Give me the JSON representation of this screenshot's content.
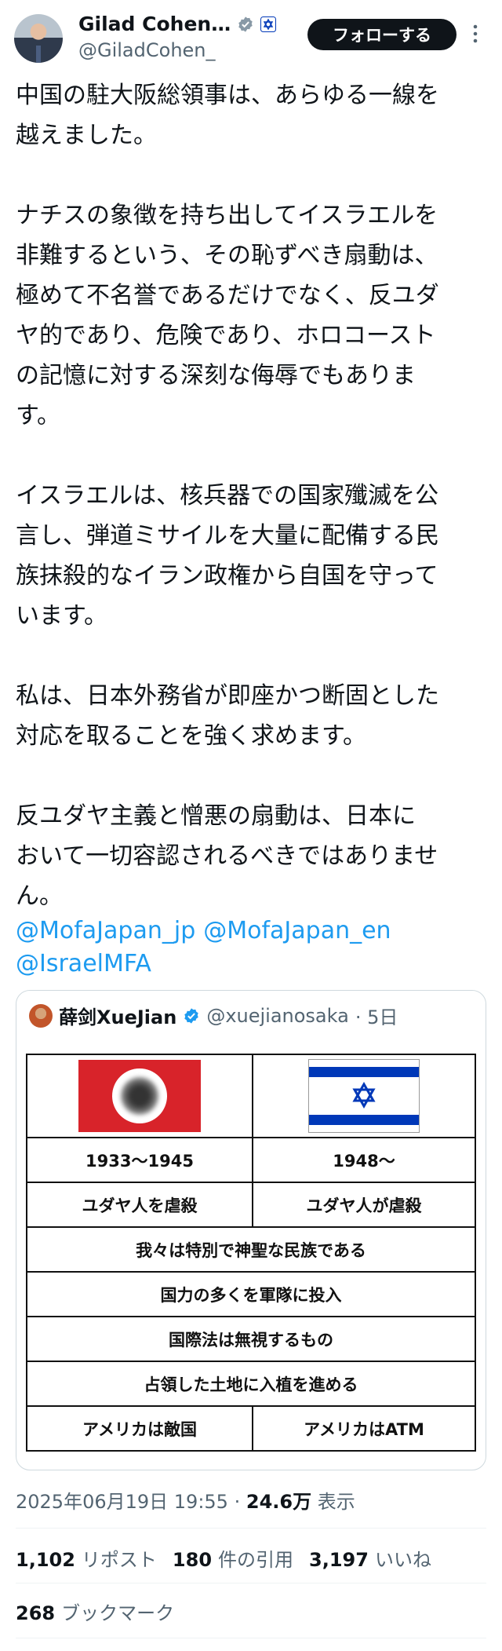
{
  "author": {
    "name": "Gilad Cohen…",
    "handle": "@GiladCohen_",
    "follow_label": "フォローする"
  },
  "tweet": {
    "paragraphs": [
      "中国の駐大阪総領事は、あらゆる一線を\n越えました。",
      "ナチスの象徴を持ち出してイスラエルを\n非難するという、その恥ずべき扇動は、\n極めて不名誉であるだけでなく、反ユダ\nヤ的であり、危険であり、ホロコースト\nの記憶に対する深刻な侮辱でもありま\nす。",
      "イスラエルは、核兵器での国家殲滅を公\n言し、弾道ミサイルを大量に配備する民\n族抹殺的なイラン政権から自国を守って\nいます。",
      "私は、日本外務省が即座かつ断固とした\n対応を取ることを強く求めます。",
      "反ユダヤ主義と憎悪の扇動は、日本に\nおいて一切容認されるべきではありませ\nん。"
    ],
    "mentions": [
      "@MofaJapan_jp",
      "@MofaJapan_en",
      "@IsraelMFA"
    ]
  },
  "quoted": {
    "name": "薛剑XueJian",
    "handle": "@xuejianosaka",
    "time": "· 5日",
    "table": {
      "years_left": "1933〜1945",
      "years_right": "1948〜",
      "row2_left": "ユダヤ人を虐殺",
      "row2_right": "ユダヤ人が虐殺",
      "merged1": "我々は特別で神聖な民族である",
      "merged2": "国力の多くを軍隊に投入",
      "merged3": "国際法は無視するもの",
      "merged4": "占領した土地に入植を進める",
      "last_left": "アメリカは敵国",
      "last_right": "アメリカはATM"
    }
  },
  "meta": {
    "datetime": "2025年06月19日 19:55",
    "separator": "·",
    "views": "24.6万",
    "views_label": "表示"
  },
  "stats": {
    "reposts": "1,102",
    "reposts_label": "リポスト",
    "quotes": "180",
    "quotes_label": "件の引用",
    "likes": "3,197",
    "likes_label": "いいね",
    "bookmarks": "268",
    "bookmarks_label": "ブックマーク"
  },
  "colors": {
    "link": "#1d9bf0",
    "verified": "#1d9bf0",
    "muted": "#536471"
  },
  "icons": [
    "verified-badge-icon",
    "flag-badge-icon",
    "more-options-icon"
  ]
}
